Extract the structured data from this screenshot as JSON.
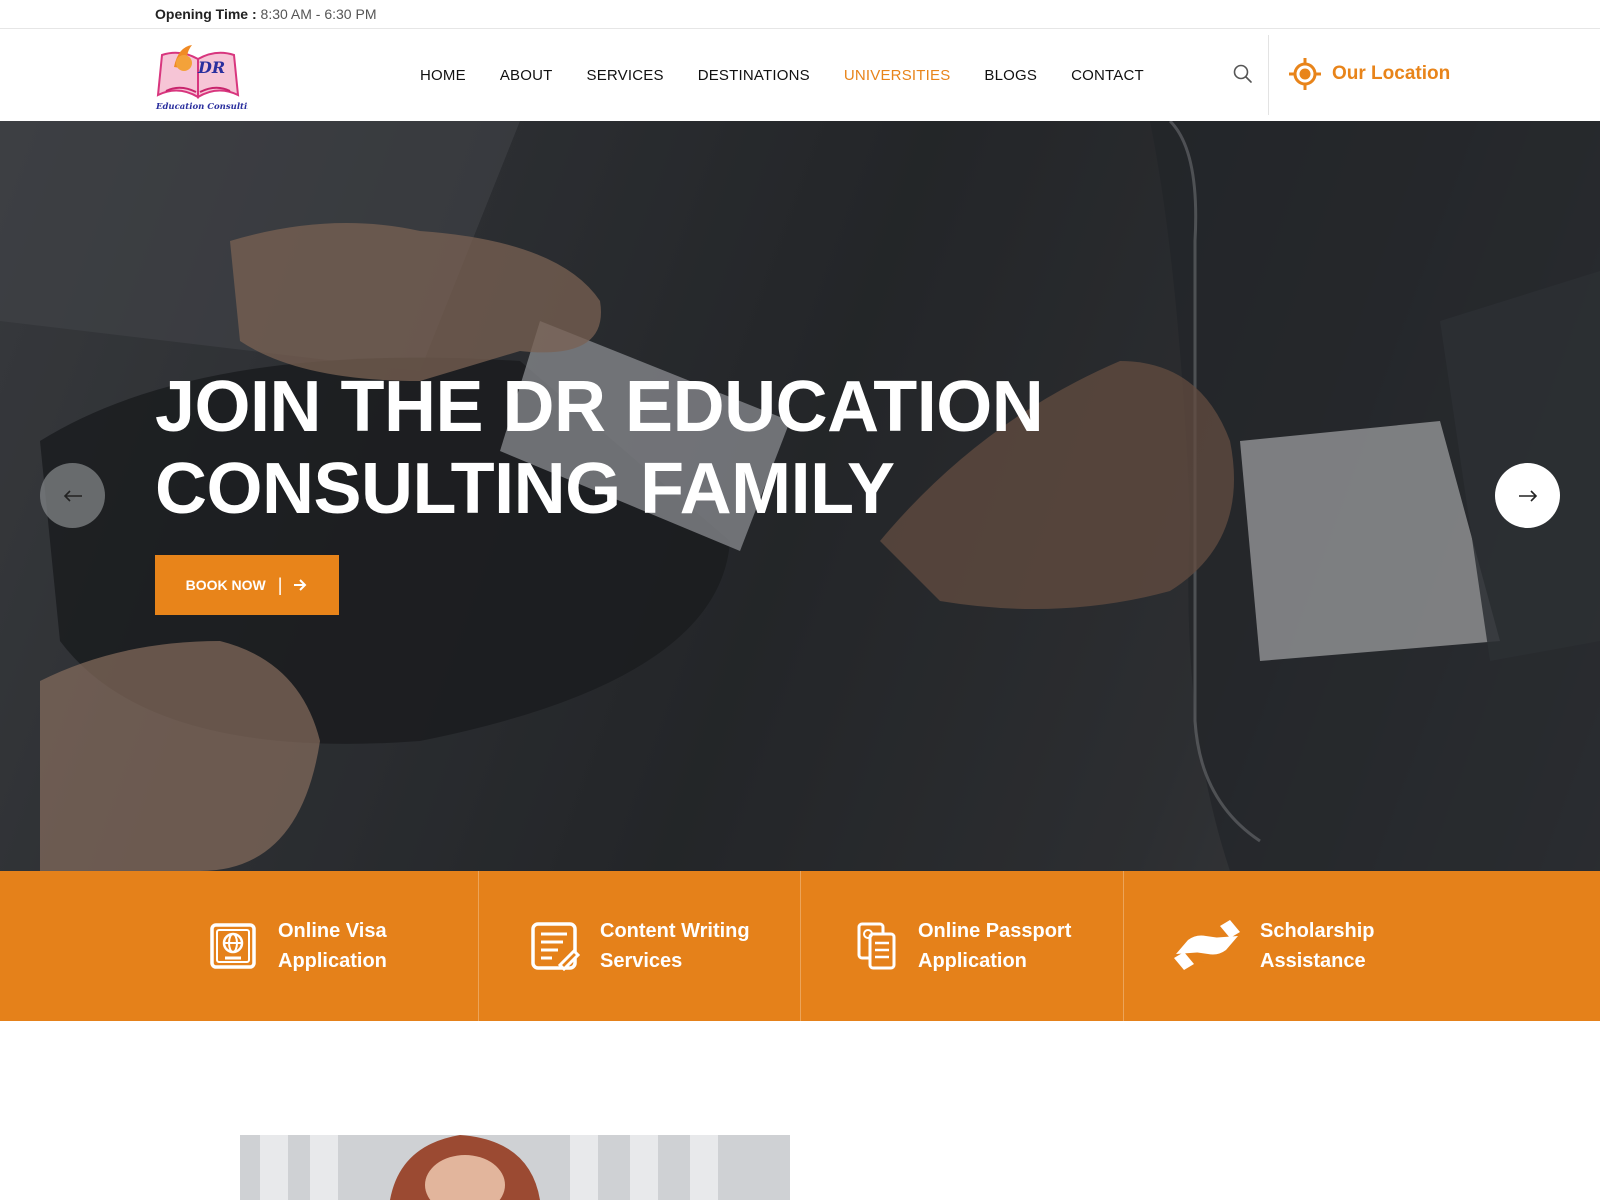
{
  "topbar": {
    "opening_label": "Opening Time :",
    "opening_value": "8:30 AM - 6:30 PM"
  },
  "header": {
    "logo": {
      "icon": "book-logo",
      "text_top": "DR",
      "text_bottom": "Education Consulting"
    },
    "nav": [
      {
        "label": "HOME"
      },
      {
        "label": "ABOUT"
      },
      {
        "label": "SERVICES"
      },
      {
        "label": "DESTINATIONS"
      },
      {
        "label": "UNIVERSITIES",
        "active": true
      },
      {
        "label": "BLOGS"
      },
      {
        "label": "CONTACT"
      }
    ],
    "search_icon": "search-icon",
    "location_label": "Our Location",
    "location_icon": "crosshair-icon"
  },
  "hero": {
    "title_line1": "JOIN THE DR EDUCATION",
    "title_line2": "CONSULTING FAMILY",
    "cta_label": "BOOK NOW",
    "cta_separator": "|",
    "prev_icon": "arrow-left-icon",
    "next_icon": "arrow-right-icon"
  },
  "services": [
    {
      "line1": "Online Visa",
      "line2": "Application",
      "icon": "passport-icon"
    },
    {
      "line1": "Content Writing",
      "line2": "Services",
      "icon": "document-edit-icon"
    },
    {
      "line1": "Online Passport",
      "line2": "Application",
      "icon": "documents-icon"
    },
    {
      "line1": "Scholarship",
      "line2": "Assistance",
      "icon": "handshake-icon"
    }
  ],
  "colors": {
    "accent": "#e8841a",
    "strip": "#e5811a",
    "text": "#111111",
    "white": "#ffffff"
  }
}
